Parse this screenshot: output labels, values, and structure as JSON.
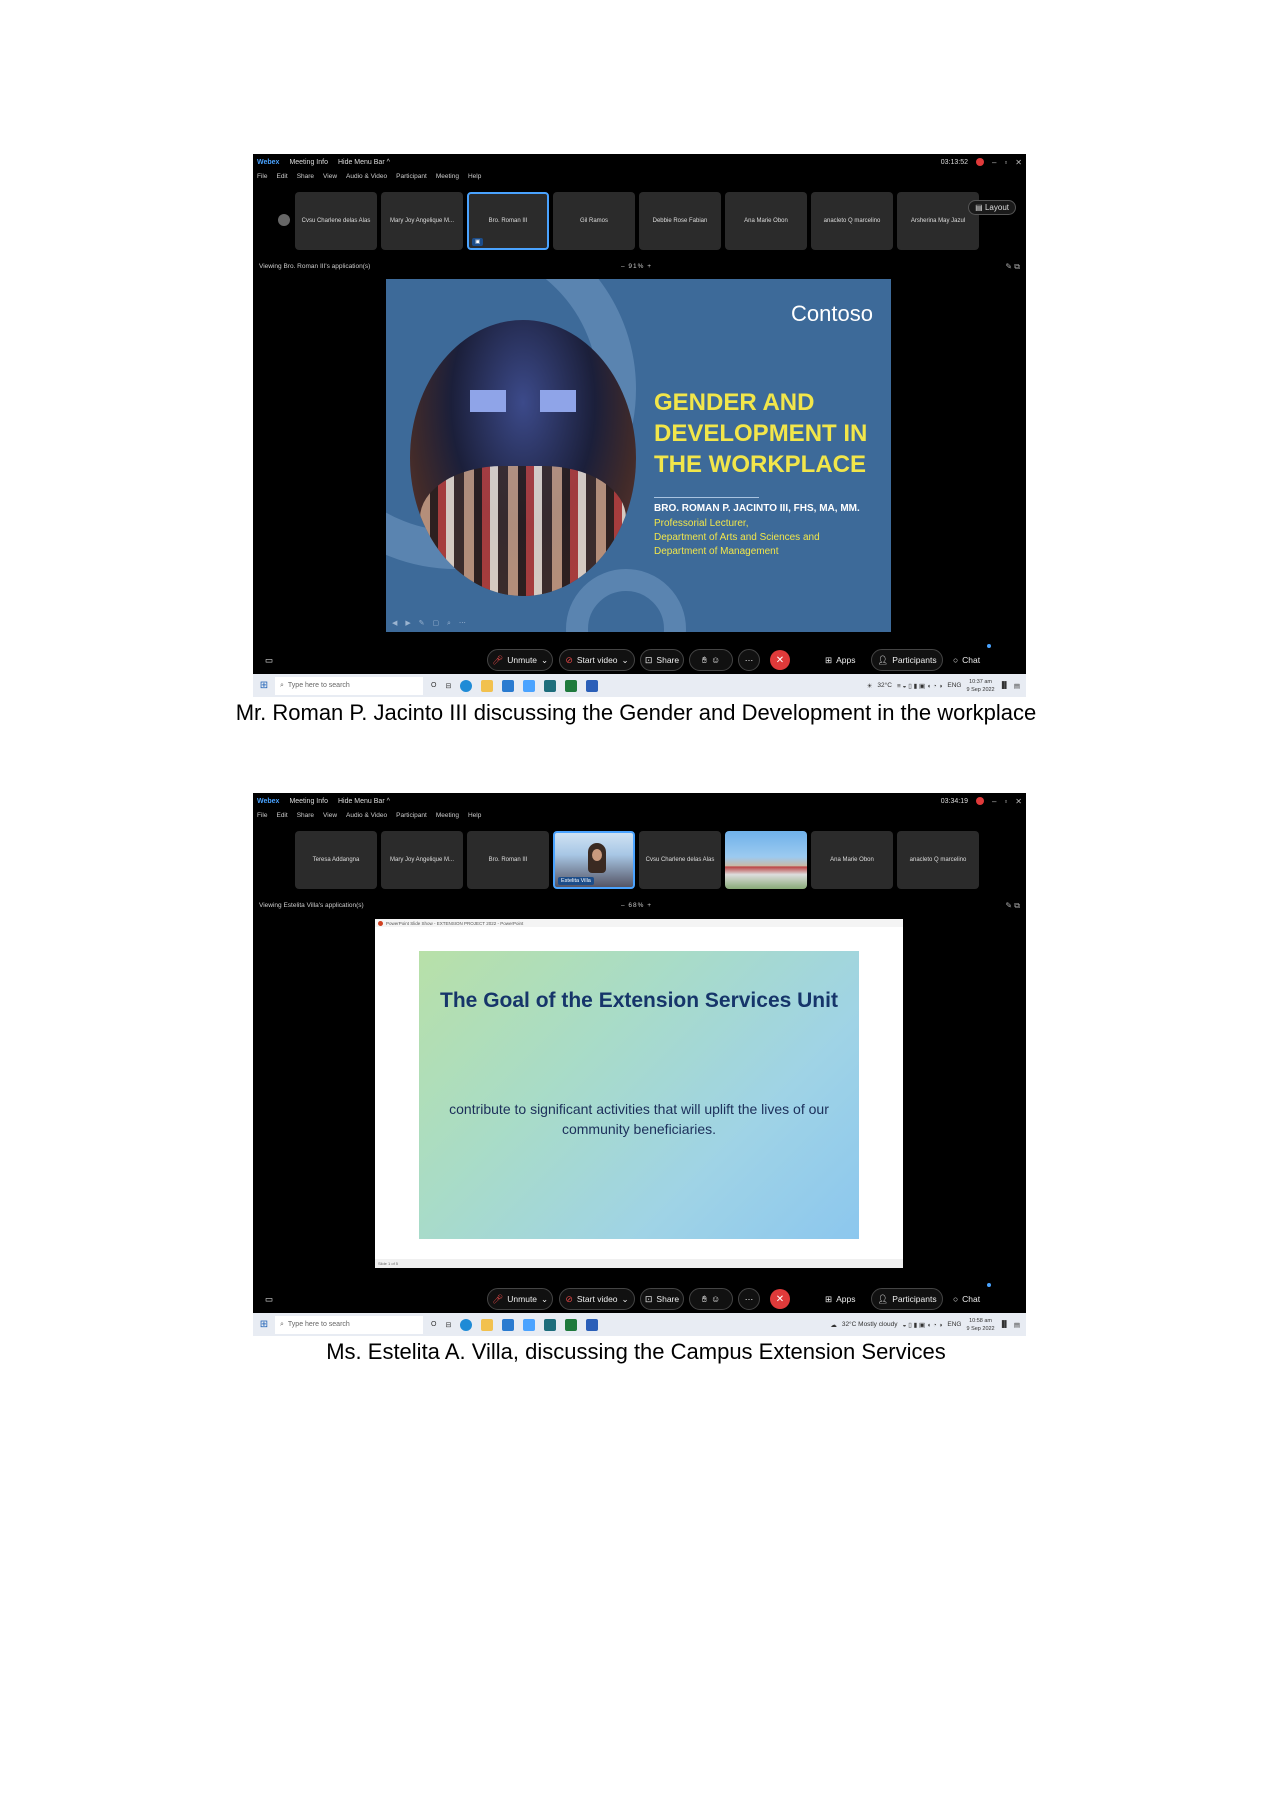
{
  "screenshot1": {
    "titlebar": {
      "app": "Webex",
      "meeting_info": "Meeting Info",
      "hide_menu": "Hide Menu Bar ^",
      "timer": "03:13:52"
    },
    "menu": [
      "File",
      "Edit",
      "Share",
      "View",
      "Audio & Video",
      "Participant",
      "Meeting",
      "Help"
    ],
    "participants": [
      "Cvsu Charlene delas Alas",
      "Mary Joy Angelique M...",
      "Bro. Roman III",
      "Gil Ramos",
      "Debbie Rose Fabian",
      "Ana Marie Obon",
      "anacleto Q marcelino",
      "Arsherina May Jazul"
    ],
    "layout_label": "Layout",
    "viewing": "Viewing Bro. Roman III's application(s)",
    "zoom": "91%",
    "slide": {
      "logo": "Contoso",
      "title_lines": [
        "GENDER AND",
        "DEVELOPMENT IN",
        "THE WORKPLACE"
      ],
      "presenter": "BRO. ROMAN P. JACINTO III, FHS, MA, MM.",
      "roles": [
        "Professorial Lecturer,",
        "Department of Arts and Sciences and",
        "Department of Management"
      ]
    },
    "controls": {
      "unmute": "Unmute",
      "start_video": "Start video",
      "share": "Share",
      "apps": "Apps",
      "participants": "Participants",
      "chat": "Chat"
    },
    "taskbar": {
      "search_placeholder": "Type here to search",
      "weather": "32°C",
      "lang": "ENG",
      "time": "10:37 am",
      "date": "9 Sep 2022"
    }
  },
  "screenshot2": {
    "titlebar": {
      "app": "Webex",
      "meeting_info": "Meeting Info",
      "hide_menu": "Hide Menu Bar ^",
      "timer": "03:34:19"
    },
    "menu": [
      "File",
      "Edit",
      "Share",
      "View",
      "Audio & Video",
      "Participant",
      "Meeting",
      "Help"
    ],
    "participants": [
      "Teresa Addangna",
      "Mary Joy Angelique M...",
      "Bro. Roman III",
      "Estelita Villa",
      "Cvsu Charlene delas Alas",
      "",
      "Ana Marie Obon",
      "anacleto Q marcelino"
    ],
    "viewing": "Viewing Estelita Villa's application(s)",
    "zoom": "68%",
    "ppt_title": "PowerPoint Slide Show - EXTENSION PROJECT 2022 - PowerPoint",
    "slide": {
      "title": "The Goal of the Extension Services Unit",
      "body_lines": [
        "contribute to significant activities that will uplift the lives of our",
        "community beneficiaries."
      ]
    },
    "slide_counter": "Slide 1 of 5",
    "controls": {
      "unmute": "Unmute",
      "start_video": "Start video",
      "share": "Share",
      "apps": "Apps",
      "participants": "Participants",
      "chat": "Chat"
    },
    "taskbar": {
      "search_placeholder": "Type here to search",
      "weather": "32°C Mostly cloudy",
      "lang": "ENG",
      "time": "10:58 am",
      "date": "9 Sep 2022"
    }
  },
  "captions": {
    "first": "Mr. Roman P. Jacinto III discussing the Gender and Development in the workplace",
    "second": "Ms. Estelita A. Villa, discussing the Campus Extension Services"
  }
}
